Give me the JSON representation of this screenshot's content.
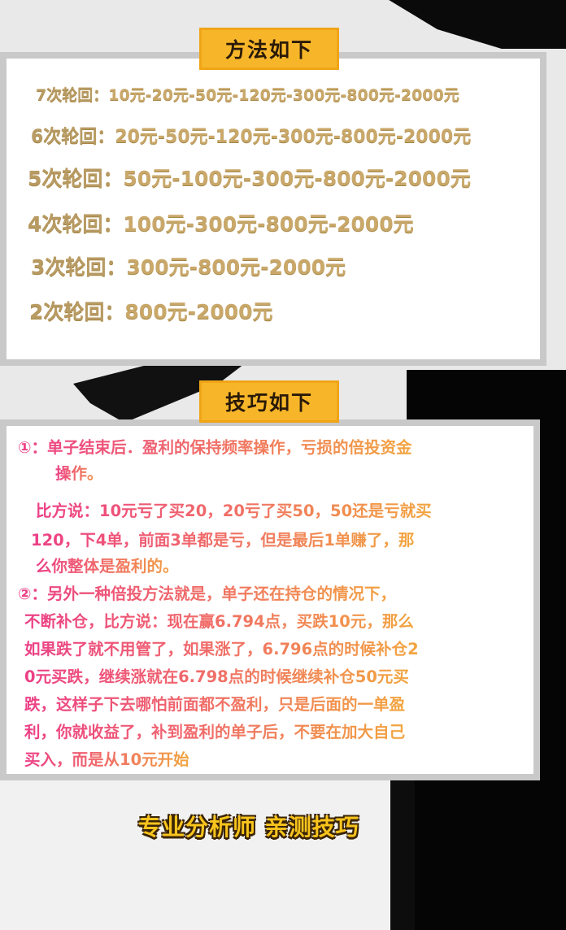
{
  "method_header": "方法如下",
  "rounds": [
    {
      "label": "7次轮回：",
      "seq": "10元-20元-50元-120元-300元-800元-2000元"
    },
    {
      "label": "6次轮回：",
      "seq": "20元-50元-120元-300元-800元-2000元"
    },
    {
      "label": "5次轮回：",
      "seq": "50元-100元-300元-800元-2000元"
    },
    {
      "label": "4次轮回：",
      "seq": "100元-300元-800元-2000元"
    },
    {
      "label": "3次轮回：",
      "seq": "300元-800元-2000元"
    },
    {
      "label": "2次轮回：",
      "seq": "800元-2000元"
    }
  ],
  "tips_header": "技巧如下",
  "tips": {
    "t1_line1": "①：单子结束后．盈利的保持频率操作，亏损的倍投资金",
    "t1_line2": "操作。",
    "ex_line1": "比方说：10元亏了买20，20亏了买50，50还是亏就买",
    "ex_line2": "120，下4单，前面3单都是亏，但是最后1单赚了，那",
    "ex_line3": "么你整体是盈利的。",
    "t2_line1": "②：另外一种倍投方法就是，单子还在持仓的情况下，",
    "t2_line2": "不断补仓，比方说：现在赢6.794点，买跌10元，那么",
    "t2_line3": "如果跌了就不用管了，如果涨了，6.796点的时候补仓2",
    "t2_line4": "0元买跌，继续涨就在6.798点的时候继续补仓50元买",
    "t2_line5": "跌，这样子下去哪怕前面都不盈利，只是后面的一单盈",
    "t2_line6": "利，你就收益了，补到盈利的单子后，不要在加大自己",
    "t2_line7": "买入，而是从10元开始"
  },
  "footer_slogan": "专业分析师  亲测技巧"
}
